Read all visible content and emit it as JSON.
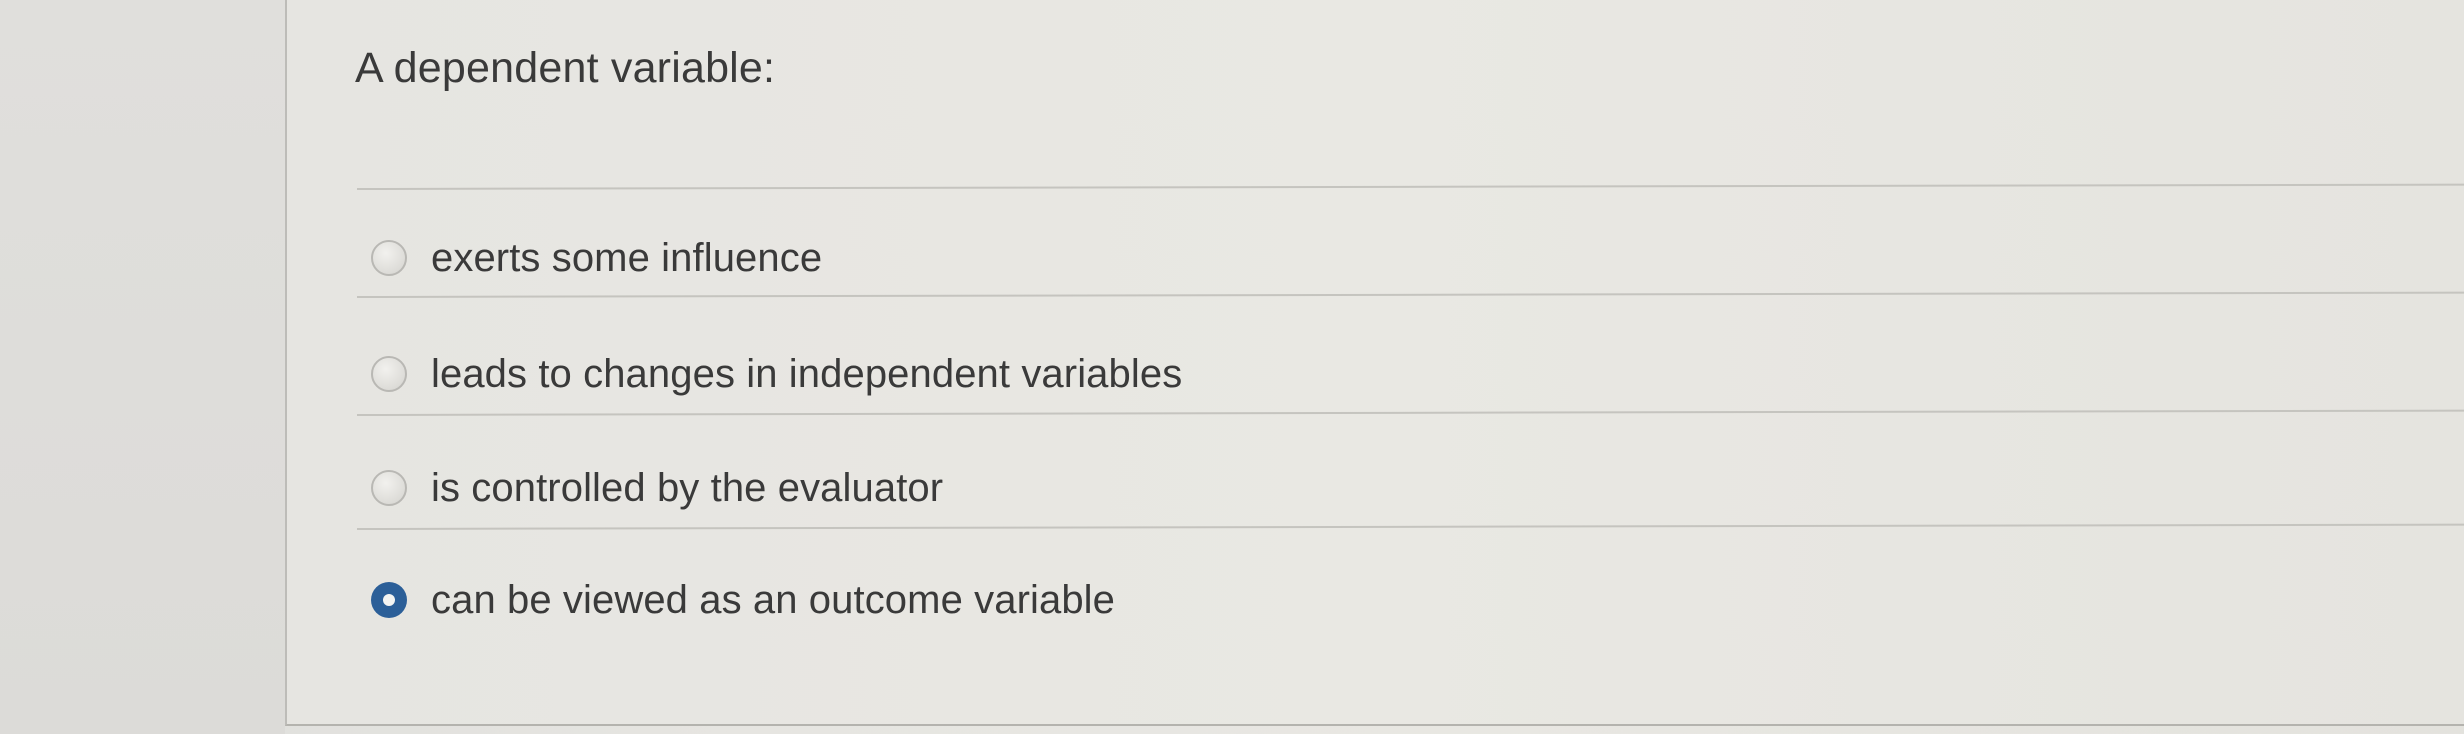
{
  "question": {
    "title": "A dependent variable:"
  },
  "options": [
    {
      "label": "exerts some influence",
      "selected": false
    },
    {
      "label": "leads to changes in independent variables",
      "selected": false
    },
    {
      "label": "is controlled by the evaluator",
      "selected": false
    },
    {
      "label": "can be viewed as an outcome variable",
      "selected": true
    }
  ],
  "colors": {
    "selected_radio": "#2c5f98",
    "text": "#3a3a3a",
    "background": "#e6e5e1"
  }
}
